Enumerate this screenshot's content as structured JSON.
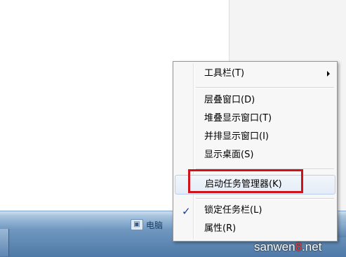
{
  "context_menu": {
    "items": [
      {
        "label": "工具栏(T)",
        "has_submenu": true
      },
      {
        "label": "层叠窗口(D)"
      },
      {
        "label": "堆叠显示窗口(T)"
      },
      {
        "label": "并排显示窗口(I)"
      },
      {
        "label": "显示桌面(S)"
      },
      {
        "label": "启动任务管理器(K)",
        "highlighted": true
      },
      {
        "label": "锁定任务栏(L)",
        "checked": true
      },
      {
        "label": "属性(R)"
      }
    ]
  },
  "taskbar": {
    "tray_text": "电脑"
  },
  "watermark": {
    "text_main": "sanwen",
    "text_accent": "8",
    "text_tail": ".net"
  },
  "colors": {
    "highlight_border": "#d0121b",
    "taskbar": "#4e78a6"
  },
  "icons": {
    "submenu_arrow": "arrow-right-icon",
    "check": "checkmark-icon",
    "tray": "tray-app-icon"
  }
}
